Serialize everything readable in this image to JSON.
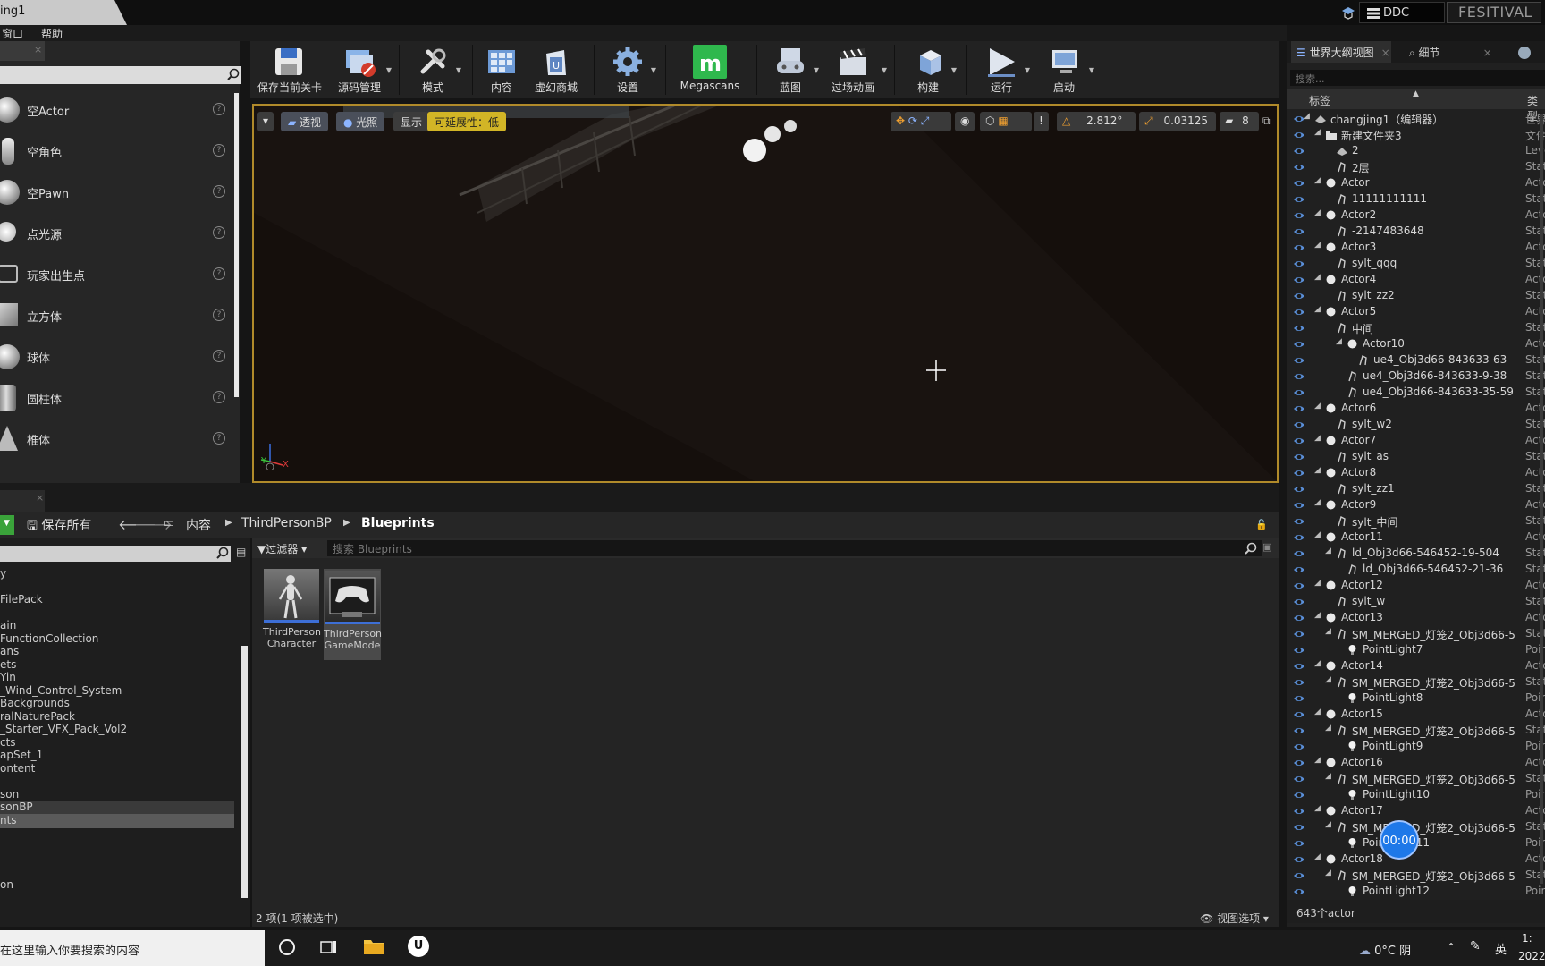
{
  "window": {
    "title_tab": "ing1",
    "ddc_label": "DDC",
    "project_badge": "FESITIVAL"
  },
  "menu": {
    "items": [
      "窗口",
      "帮助"
    ]
  },
  "place_panel": {
    "items": [
      "空Actor",
      "空角色",
      "空Pawn",
      "点光源",
      "玩家出生点",
      "立方体",
      "球体",
      "圆柱体",
      "椎体"
    ]
  },
  "toolbar": {
    "buttons": [
      "保存当前关卡",
      "源码管理",
      "模式",
      "内容",
      "虚幻商城",
      "设置",
      "Megascans",
      "蓝图",
      "过场动画",
      "构建",
      "运行",
      "启动"
    ]
  },
  "viewport": {
    "perspective_label": "透视",
    "lit_label": "光照",
    "show_label": "显示",
    "scalability_label": "可延展性：低",
    "rotation_snap": "2.812°",
    "scale_snap": "0.03125",
    "camera_speed": "8",
    "axis_y": "Y",
    "axis_x": "X"
  },
  "outliner": {
    "tabs": [
      "世界大纲视图",
      "细节"
    ],
    "search_placeholder": "搜索...",
    "col_label": "标签",
    "col_type": "类型",
    "rows": [
      {
        "indent": 0,
        "tri": "◢",
        "icon": "level",
        "name": "changjing1（编辑器）",
        "type": "世界"
      },
      {
        "indent": 1,
        "tri": "◢",
        "icon": "folder",
        "name": "新建文件夹3",
        "type": "文件"
      },
      {
        "indent": 2,
        "tri": "",
        "icon": "level",
        "name": "2",
        "type": "Leve"
      },
      {
        "indent": 2,
        "tri": "",
        "icon": "mesh",
        "name": "2层",
        "type": "Stati"
      },
      {
        "indent": 1,
        "tri": "◢",
        "icon": "actor",
        "name": "Actor",
        "type": "Acto"
      },
      {
        "indent": 2,
        "tri": "",
        "icon": "mesh",
        "name": "11111111111",
        "type": "Stati"
      },
      {
        "indent": 1,
        "tri": "◢",
        "icon": "actor",
        "name": "Actor2",
        "type": "Acto"
      },
      {
        "indent": 2,
        "tri": "",
        "icon": "mesh",
        "name": "-2147483648",
        "type": "Stati"
      },
      {
        "indent": 1,
        "tri": "◢",
        "icon": "actor",
        "name": "Actor3",
        "type": "Acto"
      },
      {
        "indent": 2,
        "tri": "",
        "icon": "mesh",
        "name": "sylt_qqq",
        "type": "Stati"
      },
      {
        "indent": 1,
        "tri": "◢",
        "icon": "actor",
        "name": "Actor4",
        "type": "Acto"
      },
      {
        "indent": 2,
        "tri": "",
        "icon": "mesh",
        "name": "sylt_zz2",
        "type": "Stati"
      },
      {
        "indent": 1,
        "tri": "◢",
        "icon": "actor",
        "name": "Actor5",
        "type": "Acto"
      },
      {
        "indent": 2,
        "tri": "",
        "icon": "mesh",
        "name": "中间",
        "type": "Stati"
      },
      {
        "indent": 3,
        "tri": "◢",
        "icon": "actor",
        "name": "Actor10",
        "type": "Acto"
      },
      {
        "indent": 4,
        "tri": "",
        "icon": "mesh",
        "name": "ue4_Obj3d66-843633-63-",
        "type": "Stati"
      },
      {
        "indent": 3,
        "tri": "",
        "icon": "mesh",
        "name": "ue4_Obj3d66-843633-9-38",
        "type": "Stati"
      },
      {
        "indent": 3,
        "tri": "",
        "icon": "mesh",
        "name": "ue4_Obj3d66-843633-35-59",
        "type": "Stati"
      },
      {
        "indent": 1,
        "tri": "◢",
        "icon": "actor",
        "name": "Actor6",
        "type": "Acto"
      },
      {
        "indent": 2,
        "tri": "",
        "icon": "mesh",
        "name": "sylt_w2",
        "type": "Stati"
      },
      {
        "indent": 1,
        "tri": "◢",
        "icon": "actor",
        "name": "Actor7",
        "type": "Acto"
      },
      {
        "indent": 2,
        "tri": "",
        "icon": "mesh",
        "name": "sylt_as",
        "type": "Stati"
      },
      {
        "indent": 1,
        "tri": "◢",
        "icon": "actor",
        "name": "Actor8",
        "type": "Acto"
      },
      {
        "indent": 2,
        "tri": "",
        "icon": "mesh",
        "name": "sylt_zz1",
        "type": "Stati"
      },
      {
        "indent": 1,
        "tri": "◢",
        "icon": "actor",
        "name": "Actor9",
        "type": "Acto"
      },
      {
        "indent": 2,
        "tri": "",
        "icon": "mesh",
        "name": "sylt_中间",
        "type": "Stati"
      },
      {
        "indent": 1,
        "tri": "◢",
        "icon": "actor",
        "name": "Actor11",
        "type": "Acto"
      },
      {
        "indent": 2,
        "tri": "◢",
        "icon": "mesh",
        "name": "ld_Obj3d66-546452-19-504",
        "type": "Stati"
      },
      {
        "indent": 3,
        "tri": "",
        "icon": "mesh",
        "name": "ld_Obj3d66-546452-21-36",
        "type": "Stati"
      },
      {
        "indent": 1,
        "tri": "◢",
        "icon": "actor",
        "name": "Actor12",
        "type": "Acto"
      },
      {
        "indent": 2,
        "tri": "",
        "icon": "mesh",
        "name": "sylt_w",
        "type": "Stati"
      },
      {
        "indent": 1,
        "tri": "◢",
        "icon": "actor",
        "name": "Actor13",
        "type": "Acto"
      },
      {
        "indent": 2,
        "tri": "◢",
        "icon": "mesh",
        "name": "SM_MERGED_灯笼2_Obj3d66-5",
        "type": "Stati"
      },
      {
        "indent": 3,
        "tri": "",
        "icon": "light",
        "name": "PointLight7",
        "type": "Poin"
      },
      {
        "indent": 1,
        "tri": "◢",
        "icon": "actor",
        "name": "Actor14",
        "type": "Acto"
      },
      {
        "indent": 2,
        "tri": "◢",
        "icon": "mesh",
        "name": "SM_MERGED_灯笼2_Obj3d66-5",
        "type": "Stati"
      },
      {
        "indent": 3,
        "tri": "",
        "icon": "light",
        "name": "PointLight8",
        "type": "Poin"
      },
      {
        "indent": 1,
        "tri": "◢",
        "icon": "actor",
        "name": "Actor15",
        "type": "Acto"
      },
      {
        "indent": 2,
        "tri": "◢",
        "icon": "mesh",
        "name": "SM_MERGED_灯笼2_Obj3d66-5",
        "type": "Stati"
      },
      {
        "indent": 3,
        "tri": "",
        "icon": "light",
        "name": "PointLight9",
        "type": "Poin"
      },
      {
        "indent": 1,
        "tri": "◢",
        "icon": "actor",
        "name": "Actor16",
        "type": "Acto"
      },
      {
        "indent": 2,
        "tri": "◢",
        "icon": "mesh",
        "name": "SM_MERGED_灯笼2_Obj3d66-5",
        "type": "Stati"
      },
      {
        "indent": 3,
        "tri": "",
        "icon": "light",
        "name": "PointLight10",
        "type": "Poin"
      },
      {
        "indent": 1,
        "tri": "◢",
        "icon": "actor",
        "name": "Actor17",
        "type": "Acto"
      },
      {
        "indent": 2,
        "tri": "◢",
        "icon": "mesh",
        "name": "SM_MERGED_灯笼2_Obj3d66-5",
        "type": "Stati"
      },
      {
        "indent": 3,
        "tri": "",
        "icon": "light",
        "name": "PointLight11",
        "type": "Poin"
      },
      {
        "indent": 1,
        "tri": "◢",
        "icon": "actor",
        "name": "Actor18",
        "type": "Acto"
      },
      {
        "indent": 2,
        "tri": "◢",
        "icon": "mesh",
        "name": "SM_MERGED_灯笼2_Obj3d66-5",
        "type": "Stati"
      },
      {
        "indent": 3,
        "tri": "",
        "icon": "light",
        "name": "PointLight12",
        "type": "Poin"
      }
    ],
    "footer": "643个actor"
  },
  "content_browser": {
    "save_all": "保存所有",
    "breadcrumb": [
      "内容",
      "ThirdPersonBP",
      "Blueprints"
    ],
    "filter_label": "过滤器",
    "search_placeholder": "搜索 Blueprints",
    "folders": [
      "y",
      "",
      "FilePack",
      "",
      "ain",
      "FunctionCollection",
      "ans",
      "ets",
      "Yin",
      "_Wind_Control_System",
      "Backgrounds",
      "ralNaturePack",
      "_Starter_VFX_Pack_Vol2",
      "cts",
      "apSet_1",
      "ontent",
      "",
      "son",
      "sonBP",
      "nts",
      "",
      "",
      "",
      "",
      "on"
    ],
    "assets": [
      {
        "line1": "ThirdPerson",
        "line2": "Character"
      },
      {
        "line1": "ThirdPerson",
        "line2": "GameMode"
      }
    ],
    "status": "2 项(1 项被选中)",
    "view_options": "视图选项"
  },
  "taskbar": {
    "search_text": "在这里输入你要搜索的内容",
    "weather": "0°C 阴",
    "ime": "英",
    "clock_partial": "1:",
    "date_partial": "2022"
  },
  "overlay": {
    "timer": "00:00"
  },
  "colors": {
    "accent_blue": "#1e78e8",
    "viewport_border": "#b08a2a",
    "selection": "#3d6fd6"
  }
}
